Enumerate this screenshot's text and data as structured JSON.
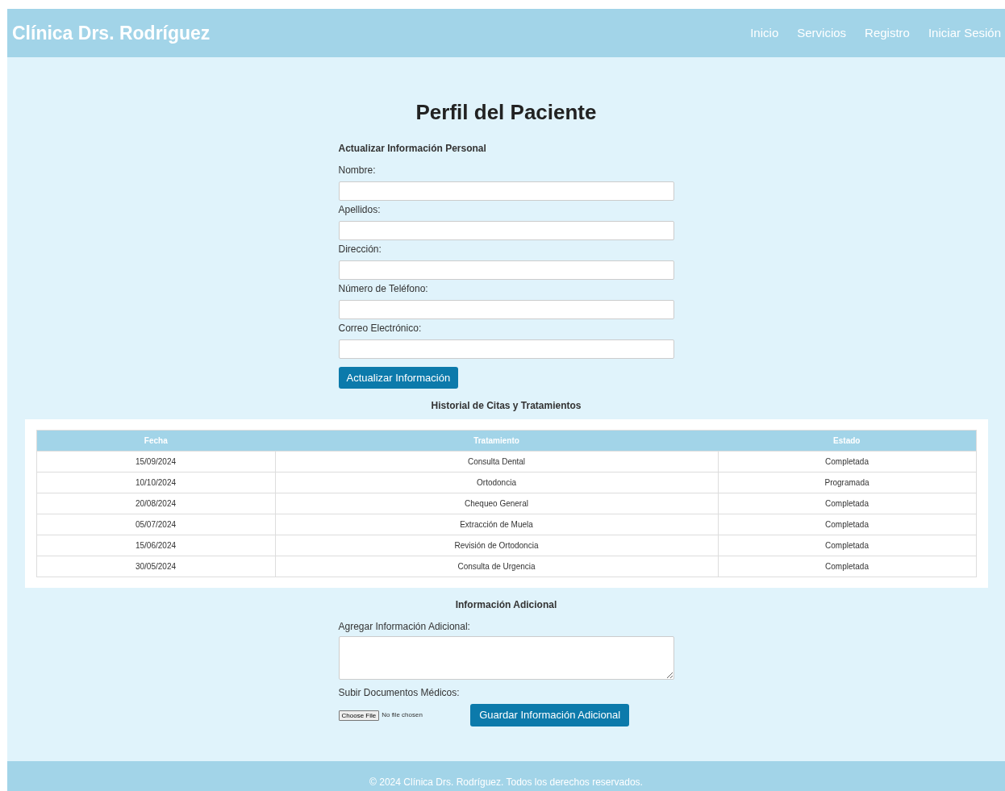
{
  "header": {
    "brand": "Clínica Drs. Rodríguez",
    "nav": [
      {
        "label": "Inicio"
      },
      {
        "label": "Servicios"
      },
      {
        "label": "Registro"
      },
      {
        "label": "Iniciar Sesión"
      }
    ]
  },
  "title": "Perfil del Paciente",
  "personal": {
    "heading": "Actualizar Información Personal",
    "fields": [
      {
        "label": "Nombre:"
      },
      {
        "label": "Apellidos:"
      },
      {
        "label": "Dirección:"
      },
      {
        "label": "Número de Teléfono:"
      },
      {
        "label": "Correo Electrónico:"
      }
    ],
    "button": "Actualizar Información"
  },
  "history": {
    "heading": "Historial de Citas y Tratamientos",
    "columns": [
      "Fecha",
      "Tratamiento",
      "Estado"
    ],
    "rows": [
      [
        "15/09/2024",
        "Consulta Dental",
        "Completada"
      ],
      [
        "10/10/2024",
        "Ortodoncia",
        "Programada"
      ],
      [
        "20/08/2024",
        "Chequeo General",
        "Completada"
      ],
      [
        "05/07/2024",
        "Extracción de Muela",
        "Completada"
      ],
      [
        "15/06/2024",
        "Revisión de Ortodoncia",
        "Completada"
      ],
      [
        "30/05/2024",
        "Consulta de Urgencia",
        "Completada"
      ]
    ]
  },
  "additional": {
    "heading": "Información Adicional",
    "textarea_label": "Agregar Información Adicional:",
    "upload_label": "Subir Documentos Médicos:",
    "file_button": "Choose File",
    "file_status": "No file chosen",
    "button": "Guardar Información Adicional"
  },
  "footer": "© 2024 Clínica Drs. Rodríguez. Todos los derechos reservados."
}
